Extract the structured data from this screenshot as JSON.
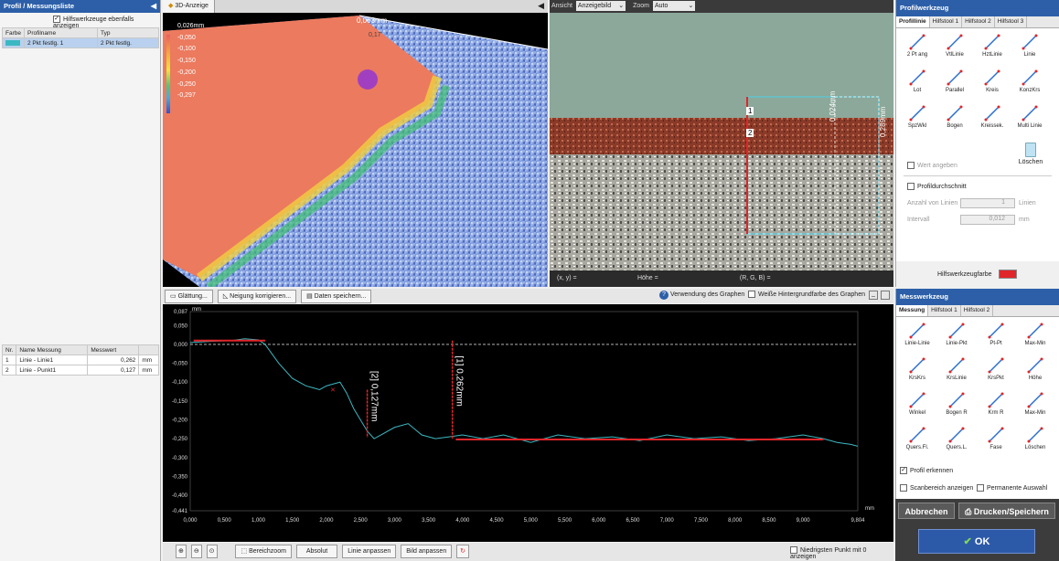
{
  "colors": {
    "accent": "#2c5fa8",
    "ok_button": "#2d5aa8",
    "measure_line": "#e0262a",
    "profile_line": "#3cb8c2"
  },
  "left": {
    "title": "Profil / Messungsliste",
    "aux_checkbox_label": "Hilfswerkzeuge ebenfalls anzeigen",
    "profile_table": {
      "headers": [
        "Farbe",
        "Profilname",
        "Typ"
      ],
      "rows": [
        {
          "name": "2 Pkt festlg. 1",
          "type": "2 Pkt festlg."
        }
      ]
    },
    "measure_table": {
      "headers": [
        "Nr.",
        "Name Messung",
        "Messwert",
        ""
      ],
      "rows": [
        [
          "1",
          "Linie - Linie1",
          "0,262",
          "mm"
        ],
        [
          "2",
          "Linie - Punkt1",
          "0,127",
          "mm"
        ]
      ]
    }
  },
  "view3d": {
    "tab": "3D-Anzeige",
    "legend": [
      "0,026mm",
      "-0,050",
      "-0,100",
      "-0,150",
      "-0,200",
      "-0,250",
      "-0,297"
    ],
    "dim_label": "0,063mm",
    "dim_tick": "0,17"
  },
  "image_view": {
    "view_label": "Ansicht",
    "view_value": "Anzeigebild",
    "zoom_label": "Zoom",
    "zoom_value": "Auto",
    "status": [
      "(x, y)  =",
      "Höhe  =",
      "(R, G, B)  ="
    ],
    "dim1": "0,024mm",
    "dim2": "0,289mm",
    "marker1": "1",
    "marker2": "2"
  },
  "graph_toolbar": {
    "smoothing": "Glättung...",
    "tilt": "Neigung korrigieren...",
    "save_data": "Daten speichern...",
    "use_graphs": "Verwendung des Graphen",
    "white_bg": "Weiße Hintergrundfarbe des Graphen"
  },
  "chart_data": {
    "type": "line",
    "xlabel": "mm",
    "ylabel": "mm",
    "xlim": [
      0,
      9.804
    ],
    "ylim": [
      -0.441,
      0.087
    ],
    "x_ticks": [
      "0,000",
      "0,500",
      "1,000",
      "1,500",
      "2,000",
      "2,500",
      "3,000",
      "3,500",
      "4,000",
      "4,500",
      "5,000",
      "5,500",
      "6,000",
      "6,500",
      "7,000",
      "7,500",
      "8,000",
      "8,500",
      "9,000",
      "9,804"
    ],
    "y_ticks": [
      "0,087",
      "0,050",
      "0,000",
      "-0,050",
      "-0,100",
      "-0,150",
      "-0,200",
      "-0,250",
      "-0,300",
      "-0,350",
      "-0,400",
      "-0,441"
    ],
    "series": [
      {
        "x": [
          0,
          0.3,
          0.6,
          0.8,
          1.0,
          1.1,
          1.3,
          1.5,
          1.7,
          1.8,
          1.9,
          2.0,
          2.1,
          2.2,
          2.3,
          2.4,
          2.5,
          2.6,
          2.7,
          2.8,
          3.0,
          3.2,
          3.4,
          3.6,
          3.8,
          4.0,
          4.3,
          4.6,
          5.0,
          5.4,
          5.8,
          6.2,
          6.6,
          7.0,
          7.4,
          7.8,
          8.2,
          8.6,
          9.0,
          9.3,
          9.5,
          9.7,
          9.804
        ],
        "y": [
          0.005,
          0.008,
          0.01,
          0.015,
          0.012,
          0.0,
          -0.05,
          -0.09,
          -0.11,
          -0.115,
          -0.12,
          -0.11,
          -0.105,
          -0.1,
          -0.13,
          -0.17,
          -0.2,
          -0.23,
          -0.25,
          -0.24,
          -0.22,
          -0.21,
          -0.24,
          -0.25,
          -0.245,
          -0.24,
          -0.25,
          -0.24,
          -0.26,
          -0.24,
          -0.25,
          -0.245,
          -0.255,
          -0.24,
          -0.25,
          -0.245,
          -0.255,
          -0.25,
          -0.24,
          -0.25,
          -0.26,
          -0.265,
          -0.27
        ]
      }
    ],
    "annotations": [
      {
        "label": "[1] 0,262mm",
        "value": 0.262
      },
      {
        "label": "[2] 0,127mm",
        "value": 0.127
      }
    ]
  },
  "bottom_bar": {
    "area_zoom": "Bereichzoom",
    "absolute": "Absolut",
    "fit_line": "Linie anpassen",
    "fit_image": "Bild anpassen",
    "lowest_point": "Niedrigsten Punkt mit 0 anzeigen"
  },
  "profile_tool": {
    "title": "Profilwerkzeug",
    "tabs": [
      "Profillinie",
      "Hilfstool 1",
      "Hilfstool 2",
      "Hilfstool 3"
    ],
    "tools": [
      "2 Pt ang",
      "VtlLinie",
      "HztLinie",
      "Linie",
      "Lot",
      "Parallel",
      "Kreis",
      "KonzKrs",
      "SpzWkl",
      "Bogen",
      "Kreissek.",
      "Multi Linie"
    ],
    "value_label": "Wert angeben",
    "delete": "Löschen",
    "cross_section": "Profildurchschnitt",
    "num_lines_label": "Anzahl von Linien",
    "num_lines_value": "1",
    "num_lines_unit": "Linien",
    "interval_label": "Intervall",
    "interval_value": "0,012",
    "interval_unit": "mm",
    "aux_color": "Hilfswerkzeugfarbe"
  },
  "measure_tool": {
    "title": "Messwerkzeug",
    "tabs": [
      "Messung",
      "Hilfstool 1",
      "Hilfstool 2"
    ],
    "tools": [
      "Linie-Linie",
      "Linie-Pkt",
      "Pt-Pt",
      "Max-Min",
      "KrsKrs",
      "KrsLinie",
      "KrsPkt",
      "Höhe",
      "Winkel",
      "Bogen R",
      "Krm R",
      "Max-Min",
      "Quers.Fl.",
      "Quers.L.",
      "Fase",
      "Löschen"
    ],
    "detect_profile": "Profil erkennen",
    "scan_area": "Scanbereich anzeigen",
    "permanent": "Permanente Auswahl"
  },
  "actions": {
    "cancel": "Abbrechen",
    "print_save": "Drucken/Speichern",
    "ok": "OK"
  }
}
